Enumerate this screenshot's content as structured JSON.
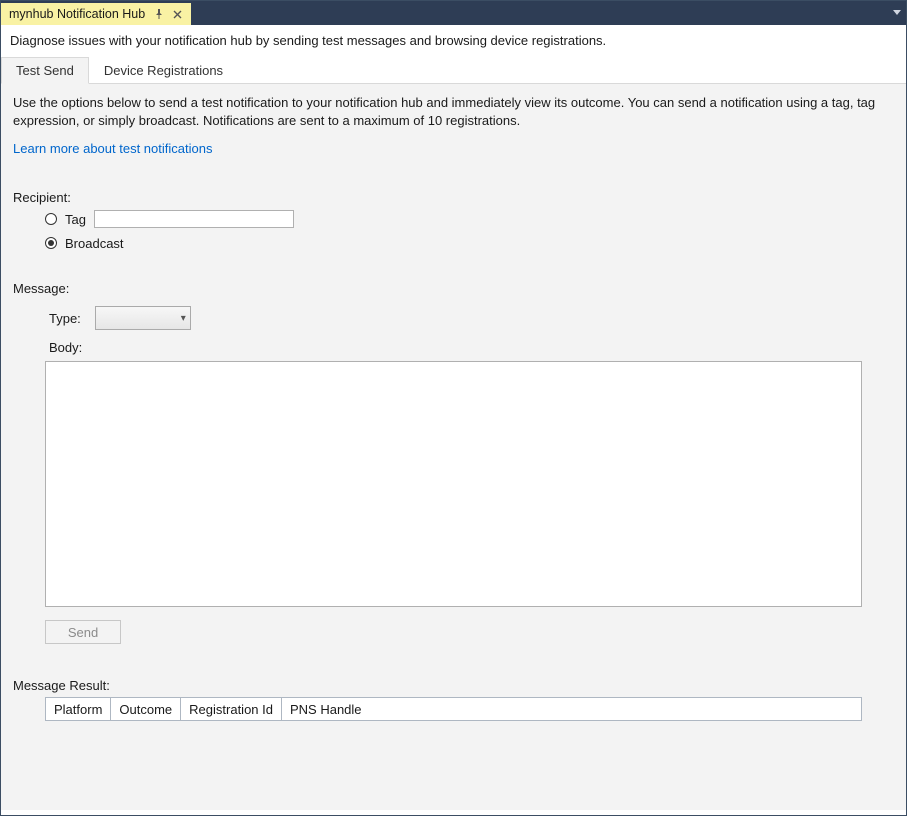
{
  "titlebar": {
    "tab_title": "mynhub Notification Hub"
  },
  "header": {
    "description": "Diagnose issues with your notification hub by sending test messages and browsing device registrations."
  },
  "tabs": {
    "test_send": "Test Send",
    "device_registrations": "Device Registrations"
  },
  "test_send": {
    "intro": "Use the options below to send a test notification to your notification hub and immediately view its outcome. You can send a notification using a tag, tag expression, or simply broadcast. Notifications are sent to a maximum of 10 registrations.",
    "learn_more": "Learn more about test notifications",
    "recipient_label": "Recipient:",
    "tag_label": "Tag",
    "broadcast_label": "Broadcast",
    "recipient_selected": "broadcast",
    "tag_value": "",
    "message_label": "Message:",
    "type_label": "Type:",
    "type_value": "",
    "body_label": "Body:",
    "body_value": "",
    "send_label": "Send",
    "result_label": "Message Result:",
    "result_columns": {
      "platform": "Platform",
      "outcome": "Outcome",
      "registration_id": "Registration Id",
      "pns_handle": "PNS Handle"
    },
    "result_rows": []
  }
}
